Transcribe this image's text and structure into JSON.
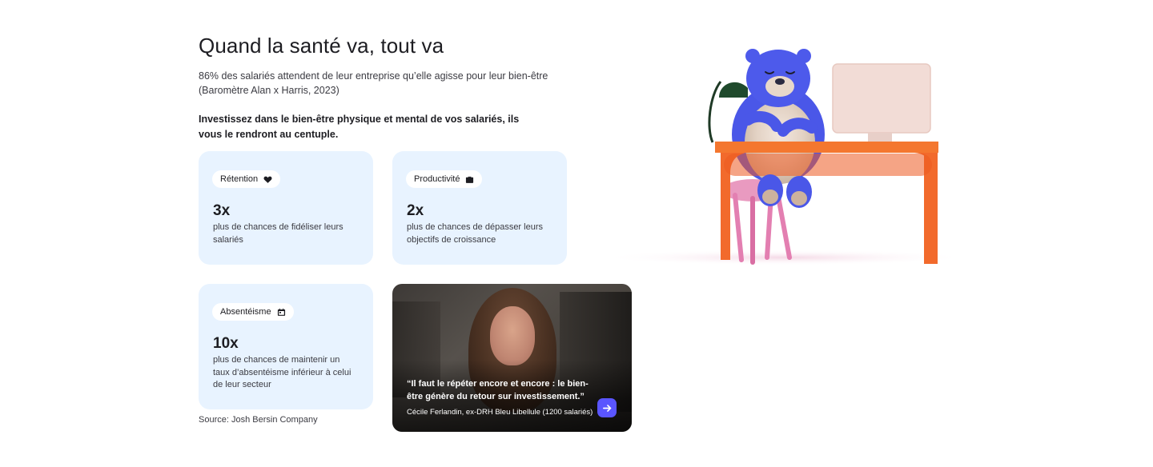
{
  "header": {
    "title": "Quand la santé va, tout va",
    "intro_text": "86% des salariés attendent de leur entreprise qu’elle agisse pour leur bien-être",
    "intro_source": "(Baromètre Alan x Harris, 2023)",
    "lead": "Investissez dans le bien-être physique et mental de vos salariés, ils vous le rendront au centuple."
  },
  "stats": [
    {
      "label": "Rétention",
      "icon": "heart-icon",
      "value": "3x",
      "description": "plus de chances de fidéliser leurs salariés"
    },
    {
      "label": "Productivité",
      "icon": "briefcase-icon",
      "value": "2x",
      "description": "plus de chances de dépasser leurs objectifs de croissance"
    },
    {
      "label": "Absentéisme",
      "icon": "calendar-icon",
      "value": "10x",
      "description": "plus de chances de maintenir un taux d’absentéisme inférieur à celui de leur secteur"
    }
  ],
  "source": "Source: Josh Bersin Company",
  "testimonial": {
    "quote": "“Il faut le répéter encore et encore : le bien-être génère du retour sur investissement.”",
    "author": "Cécile Ferlandin, ex-DRH Bleu Libellule (1200 salariés)",
    "button_icon": "arrow-right-icon"
  },
  "colors": {
    "card_bg": "#e8f3ff",
    "accent": "#5a55ff",
    "desk": "#f26a2c",
    "mascot": "#4a57e8"
  },
  "illustration": "bear-mascot-at-desk"
}
